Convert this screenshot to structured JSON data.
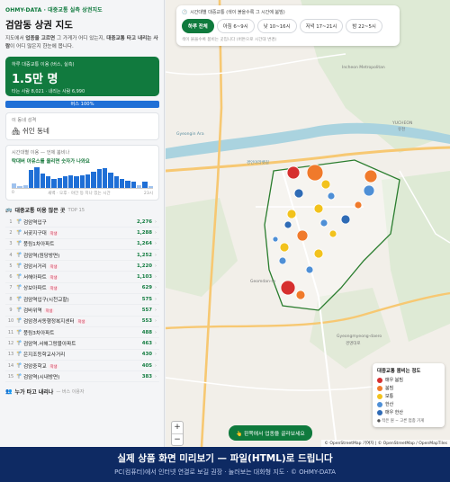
{
  "sidebar": {
    "brand": "OHMY-DATA · 대중교통 실측 상권지도",
    "title": "검암동 상권 지도",
    "desc_pre": "지도에서 ",
    "desc_b1": "업종을 고르면",
    "desc_mid": " 그 가게가 어디 있는지, ",
    "desc_b2": "대중교통 타고 내리는 사람",
    "desc_post": "이 어디 많은지 한눈에 봅니다.",
    "daily": {
      "caption": "하루 대중교통 이용 (버스, 실측)",
      "value": "1.5만 명",
      "sub": "타는 사람 8,021 · 내리는 사람 6,990"
    },
    "bus_share": "버스 100%",
    "character": {
      "label": "이 동네 성격",
      "value": "🏘 쉬인 동네"
    },
    "time": {
      "label": "시간대별 이용 — 언제 붐비나",
      "sub": "탁대버 아유스를 올리면 숫자가 나와요",
      "levels": [
        0.2,
        0.1,
        0.15,
        0.85,
        1.0,
        0.7,
        0.55,
        0.45,
        0.5,
        0.55,
        0.6,
        0.55,
        0.6,
        0.65,
        0.8,
        0.9,
        0.95,
        0.75,
        0.55,
        0.45,
        0.35,
        0.3,
        0.15,
        0.3,
        0.1
      ],
      "axis": [
        "0",
        "6시",
        "12시",
        "18시",
        "23시"
      ],
      "axis_mid": "새벽 · 오후 · 야간 등 지나 있는 시간"
    },
    "top_list": {
      "title": "대중교통 이용 많은 곳",
      "top_label": "TOP 15",
      "rows": [
        {
          "rank": "1",
          "name": "검암역입구",
          "badge": "",
          "value": "2,276"
        },
        {
          "rank": "2",
          "name": "서곶지구대",
          "badge": "학생",
          "value": "1,288"
        },
        {
          "rank": "3",
          "name": "풍림1차아파트",
          "badge": "",
          "value": "1,264"
        },
        {
          "rank": "4",
          "name": "검암역(원당방면)",
          "badge": "",
          "value": "1,252"
        },
        {
          "rank": "5",
          "name": "검암서거리",
          "badge": "학생",
          "value": "1,220"
        },
        {
          "rank": "6",
          "name": "서해아파트",
          "badge": "학생",
          "value": "1,103"
        },
        {
          "rank": "7",
          "name": "상보아파트",
          "badge": "학생",
          "value": "629"
        },
        {
          "rank": "8",
          "name": "검암역입구(시천교할)",
          "badge": "",
          "value": "575"
        },
        {
          "rank": "9",
          "name": "검바위역",
          "badge": "학생",
          "value": "557"
        },
        {
          "rank": "10",
          "name": "검암경서동행정복지센터",
          "badge": "학생",
          "value": "553"
        },
        {
          "rank": "11",
          "name": "풍림3차아파트",
          "badge": "",
          "value": "488"
        },
        {
          "rank": "12",
          "name": "검암역.서해그랑블아파트",
          "badge": "",
          "value": "463"
        },
        {
          "rank": "13",
          "name": "은지조등학교사거리",
          "badge": "",
          "value": "430"
        },
        {
          "rank": "14",
          "name": "검암중학교",
          "badge": "학생",
          "value": "405"
        },
        {
          "rank": "15",
          "name": "검암역(시내방면)",
          "badge": "",
          "value": "383"
        }
      ]
    },
    "bottom": {
      "title": "누가 타고 내리나",
      "meta": "— 버스 이용자"
    }
  },
  "map": {
    "hint": "시간대별 대중교통 (색이 붉을수록 그 시간에 붐빔)",
    "tabs": [
      "하루 전체",
      "아침 6~9시",
      "낮 10~16시",
      "저녁 17~21시",
      "밤 22~5시"
    ],
    "active_tab": 0,
    "note": "색이 붉을수록 붐비는 곳입니다 (버튼으로 시간대 변경)",
    "place_labels": [
      "Incheon Metropolitan",
      "Gyeongin Ara",
      "경인아라뱃길",
      "Gyeongmyeong-daero",
      "경명대로",
      "Geomdan-ro",
      "YUCHEON",
      "유천"
    ],
    "cta": "👆 왼쪽에서 업종을 골라보세요",
    "zoom_in": "+",
    "zoom_out": "−",
    "attribution": "© OpenStreetMap 기여자 | © OpenStreetMap / OpenMapTiles",
    "legend": {
      "title": "대중교통 붐비는 정도",
      "items": [
        {
          "label": "매우 붐빔",
          "color": "#d62f2f"
        },
        {
          "label": "붐빔",
          "color": "#f07a2b"
        },
        {
          "label": "보통",
          "color": "#f2c21c"
        },
        {
          "label": "한산",
          "color": "#4e8fd6"
        },
        {
          "label": "매우 한산",
          "color": "#2f6bb5"
        }
      ],
      "foot": "● 작은 원 − 고른 업종 가게"
    }
  },
  "footer": {
    "line1": "실제 상품 화면 미리보기 — 파일(HTML)로 드립니다",
    "line2": "PC(컴퓨터)에서 인터넷 연결로 보길 권장 · 눌러보는 대화형 지도 · © OHMY-DATA"
  }
}
